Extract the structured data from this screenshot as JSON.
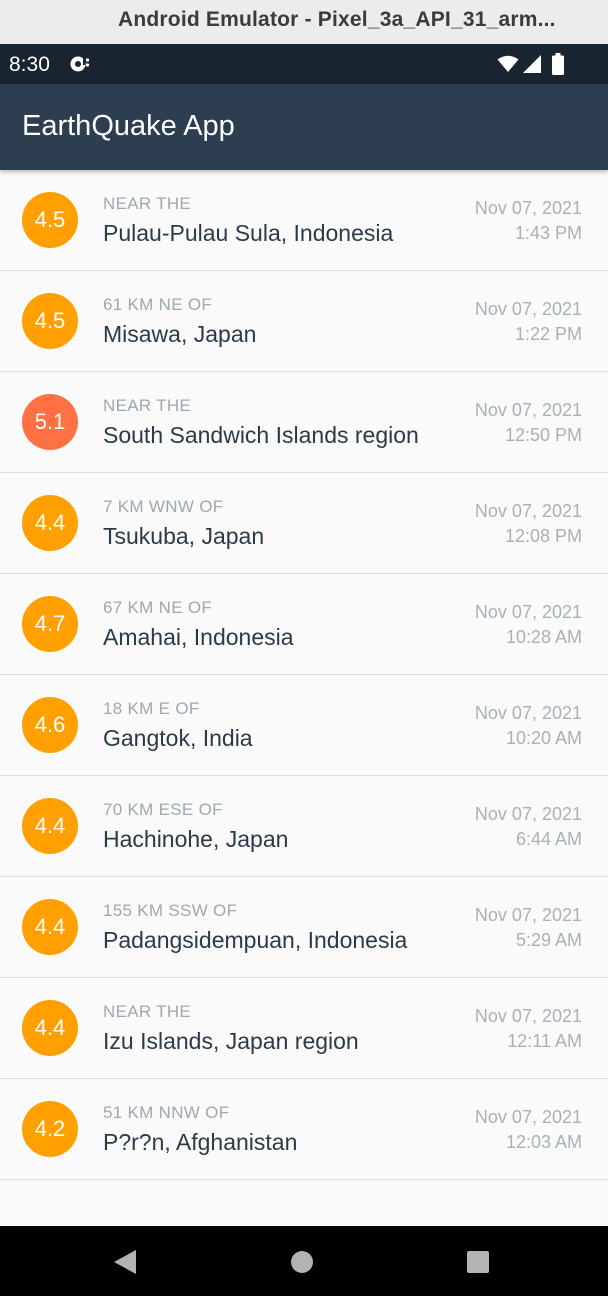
{
  "window": {
    "title": "Android Emulator - Pixel_3a_API_31_arm..."
  },
  "status_bar": {
    "time": "8:30",
    "icons": [
      "notification-icon",
      "wifi-icon",
      "signal-icon",
      "battery-icon"
    ]
  },
  "app_bar": {
    "title": "EarthQuake App",
    "color": "#2c3e50"
  },
  "colors": {
    "magnitude_4": "#ffa000",
    "magnitude_5": "#ff7043"
  },
  "earthquakes": [
    {
      "magnitude": "4.5",
      "offset": "NEAR THE",
      "primary": "Pulau-Pulau Sula, Indonesia",
      "date": "Nov 07, 2021",
      "time": "1:43 PM",
      "color": "#ffa000"
    },
    {
      "magnitude": "4.5",
      "offset": "61 KM NE OF",
      "primary": "Misawa, Japan",
      "date": "Nov 07, 2021",
      "time": "1:22 PM",
      "color": "#ffa000"
    },
    {
      "magnitude": "5.1",
      "offset": "NEAR THE",
      "primary": "South Sandwich Islands region",
      "date": "Nov 07, 2021",
      "time": "12:50 PM",
      "color": "#ff7043"
    },
    {
      "magnitude": "4.4",
      "offset": "7 KM WNW OF",
      "primary": "Tsukuba, Japan",
      "date": "Nov 07, 2021",
      "time": "12:08 PM",
      "color": "#ffa000"
    },
    {
      "magnitude": "4.7",
      "offset": "67 KM NE OF",
      "primary": "Amahai, Indonesia",
      "date": "Nov 07, 2021",
      "time": "10:28 AM",
      "color": "#ffa000"
    },
    {
      "magnitude": "4.6",
      "offset": "18 KM E OF",
      "primary": "Gangtok, India",
      "date": "Nov 07, 2021",
      "time": "10:20 AM",
      "color": "#ffa000"
    },
    {
      "magnitude": "4.4",
      "offset": "70 KM ESE OF",
      "primary": "Hachinohe, Japan",
      "date": "Nov 07, 2021",
      "time": "6:44 AM",
      "color": "#ffa000"
    },
    {
      "magnitude": "4.4",
      "offset": "155 KM SSW OF",
      "primary": "Padangsidempuan, Indonesia",
      "date": "Nov 07, 2021",
      "time": "5:29 AM",
      "color": "#ffa000"
    },
    {
      "magnitude": "4.4",
      "offset": "NEAR THE",
      "primary": "Izu Islands, Japan region",
      "date": "Nov 07, 2021",
      "time": "12:11 AM",
      "color": "#ffa000"
    },
    {
      "magnitude": "4.2",
      "offset": "51 KM NNW OF",
      "primary": "P?r?n, Afghanistan",
      "date": "Nov 07, 2021",
      "time": "12:03 AM",
      "color": "#ffa000"
    }
  ],
  "nav_bar": {
    "buttons": [
      "back-icon",
      "home-icon",
      "recents-icon"
    ]
  }
}
